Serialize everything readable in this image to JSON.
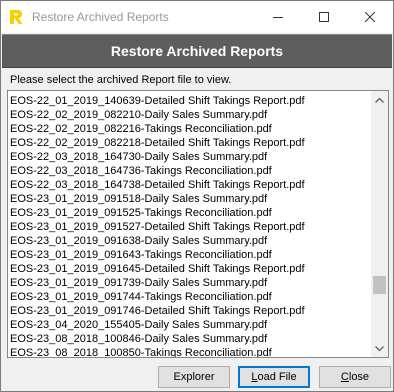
{
  "window": {
    "title": "Restore Archived Reports",
    "app_icon": "R-logo-icon",
    "controls": [
      "minimize-icon",
      "maximize-icon",
      "close-icon"
    ]
  },
  "header": {
    "title": "Restore Archived Reports"
  },
  "instruction": "Please select the archived Report file to view.",
  "files": [
    "EOS-22_01_2019_140639-Detailed Shift Takings Report.pdf",
    "EOS-22_02_2019_082210-Daily Sales Summary.pdf",
    "EOS-22_02_2019_082216-Takings Reconciliation.pdf",
    "EOS-22_02_2019_082218-Detailed Shift Takings Report.pdf",
    "EOS-22_03_2018_164730-Daily Sales Summary.pdf",
    "EOS-22_03_2018_164736-Takings Reconciliation.pdf",
    "EOS-22_03_2018_164738-Detailed Shift Takings Report.pdf",
    "EOS-23_01_2019_091518-Daily Sales Summary.pdf",
    "EOS-23_01_2019_091525-Takings Reconciliation.pdf",
    "EOS-23_01_2019_091527-Detailed Shift Takings Report.pdf",
    "EOS-23_01_2019_091638-Daily Sales Summary.pdf",
    "EOS-23_01_2019_091643-Takings Reconciliation.pdf",
    "EOS-23_01_2019_091645-Detailed Shift Takings Report.pdf",
    "EOS-23_01_2019_091739-Daily Sales Summary.pdf",
    "EOS-23_01_2019_091744-Takings Reconciliation.pdf",
    "EOS-23_01_2019_091746-Detailed Shift Takings Report.pdf",
    "EOS-23_04_2020_155405-Daily Sales Summary.pdf",
    "EOS-23_08_2018_100846-Daily Sales Summary.pdf",
    "EOS-23_08_2018_100850-Takings Reconciliation.pdf"
  ],
  "buttons": {
    "explorer": "Explorer",
    "load_file_first": "L",
    "load_file_rest": "oad File",
    "close_first": "C",
    "close_rest": "lose"
  },
  "colors": {
    "header_band": "#5e5e5e",
    "focus_border": "#0078d7",
    "logo": "#f5d100"
  }
}
